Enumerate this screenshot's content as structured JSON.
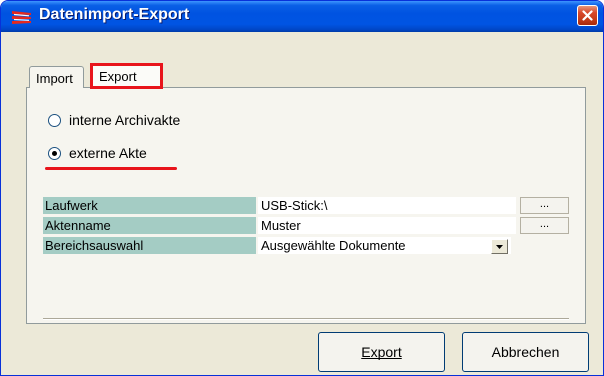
{
  "window": {
    "title": "Datenimport-Export"
  },
  "tabs": [
    {
      "label": "Import",
      "active": false
    },
    {
      "label": "Export",
      "active": true
    }
  ],
  "options": [
    {
      "label": "interne Archivakte",
      "checked": false
    },
    {
      "label": "externe Akte",
      "checked": true
    }
  ],
  "fields": [
    {
      "label": "Laufwerk",
      "value": "USB-Stick:\\",
      "browse_label": "..."
    },
    {
      "label": "Aktenname",
      "value": "Muster",
      "browse_label": "..."
    },
    {
      "label": "Bereichsauswahl",
      "value": "Ausgewählte Dokumente"
    }
  ],
  "buttons": {
    "export_label": "Export",
    "cancel_label": "Abbrechen"
  },
  "colors": {
    "highlight": "#e8141b",
    "label_bg": "#a4ccc4",
    "titlebar": "#0054e3"
  }
}
